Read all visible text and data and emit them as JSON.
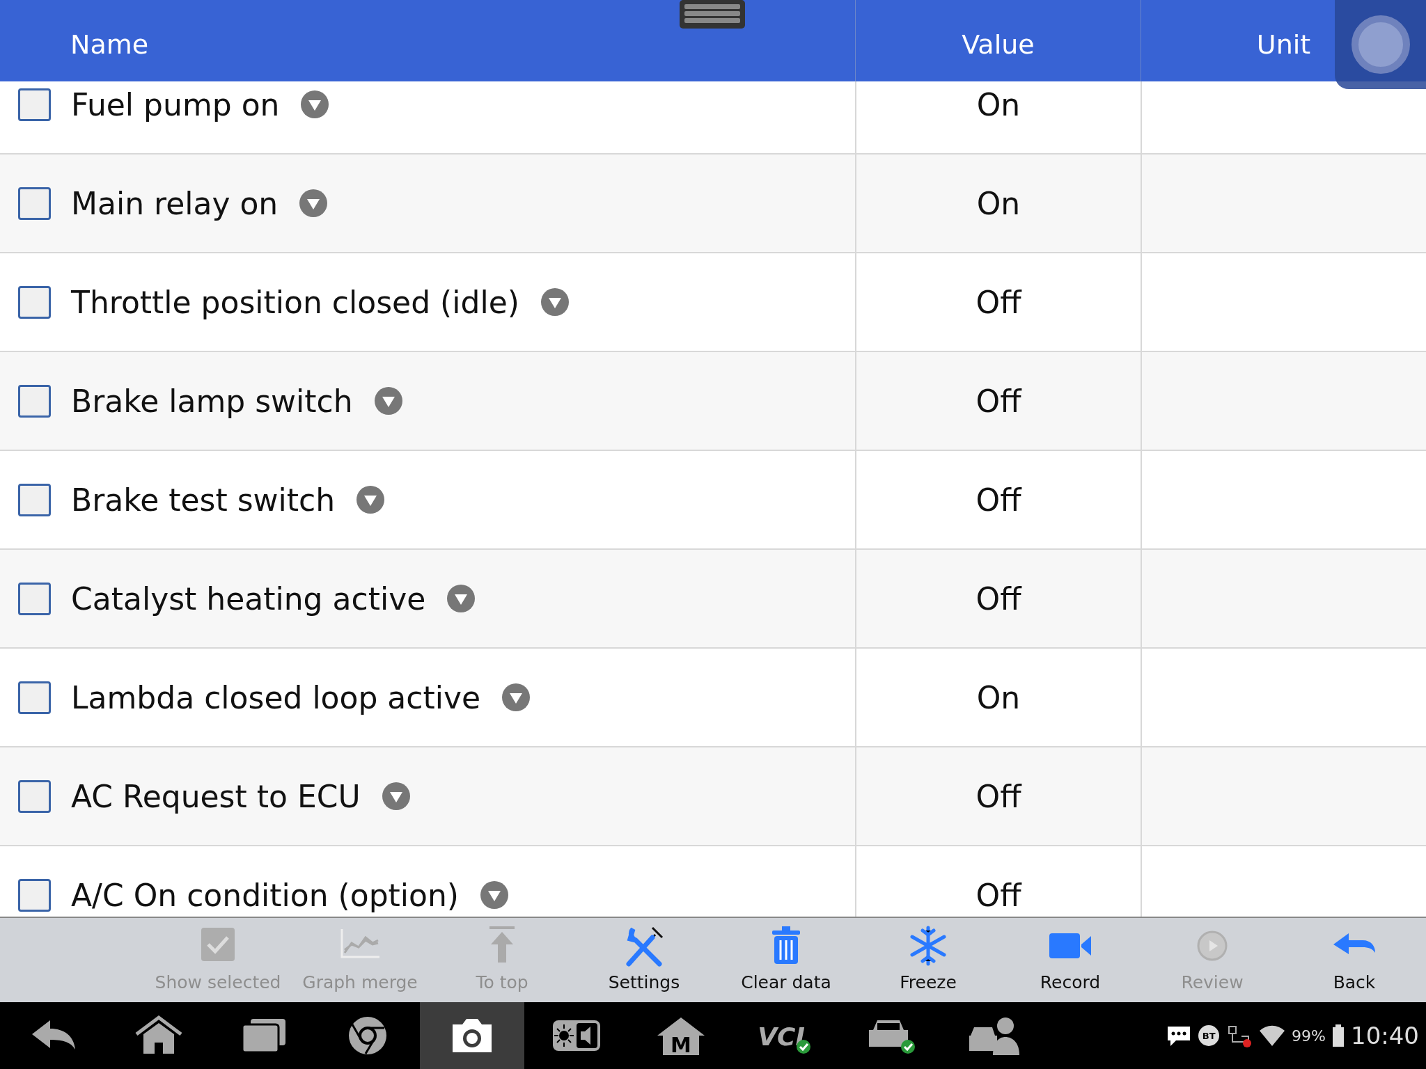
{
  "header": {
    "columns": [
      "Name",
      "Value",
      "Unit"
    ]
  },
  "rows": [
    {
      "name": "Fuel pump on",
      "value": "On",
      "checked": false
    },
    {
      "name": "Main relay on",
      "value": "On",
      "checked": false
    },
    {
      "name": "Throttle position closed (idle)",
      "value": "Off",
      "checked": false
    },
    {
      "name": "Brake lamp switch",
      "value": "Off",
      "checked": false
    },
    {
      "name": "Brake test switch",
      "value": "Off",
      "checked": false
    },
    {
      "name": "Catalyst heating active",
      "value": "Off",
      "checked": false
    },
    {
      "name": "Lambda closed loop active",
      "value": "On",
      "checked": false
    },
    {
      "name": "AC Request to ECU",
      "value": "Off",
      "checked": false
    },
    {
      "name": "A/C On condition (option)",
      "value": "Off",
      "checked": false
    }
  ],
  "toolbar": [
    {
      "kind": "show",
      "label": "Show selected",
      "disabled": true
    },
    {
      "kind": "graph",
      "label": "Graph merge",
      "disabled": true
    },
    {
      "kind": "top",
      "label": "To top",
      "disabled": true
    },
    {
      "kind": "settings",
      "label": "Settings",
      "disabled": false
    },
    {
      "kind": "clear",
      "label": "Clear data",
      "disabled": false
    },
    {
      "kind": "freeze",
      "label": "Freeze",
      "disabled": false
    },
    {
      "kind": "record",
      "label": "Record",
      "disabled": false
    },
    {
      "kind": "review",
      "label": "Review",
      "disabled": true
    },
    {
      "kind": "back",
      "label": "Back",
      "disabled": false
    }
  ],
  "nav": [
    {
      "kind": "back",
      "selected": false
    },
    {
      "kind": "home",
      "selected": false
    },
    {
      "kind": "recents",
      "selected": false
    },
    {
      "kind": "browser",
      "selected": false
    },
    {
      "kind": "camera",
      "selected": true
    },
    {
      "kind": "display",
      "selected": false
    },
    {
      "kind": "manual",
      "text": "M",
      "selected": false
    },
    {
      "kind": "vci",
      "text": "VCI",
      "selected": false
    },
    {
      "kind": "car",
      "selected": false
    },
    {
      "kind": "support",
      "selected": false
    }
  ],
  "status": {
    "bluetooth": "BT",
    "battery": "99%",
    "time": "10:40"
  }
}
